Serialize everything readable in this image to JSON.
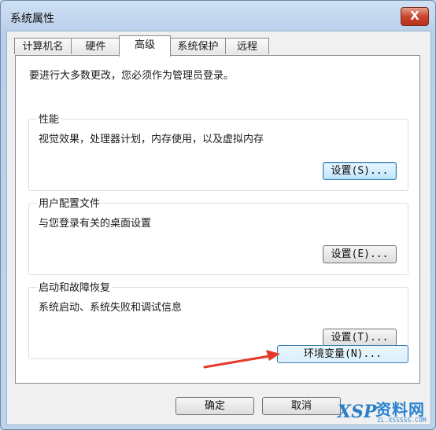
{
  "window": {
    "title": "系统属性",
    "close_label": "X"
  },
  "tabs": [
    {
      "label": "计算机名",
      "active": false
    },
    {
      "label": "硬件",
      "active": false
    },
    {
      "label": "高级",
      "active": true
    },
    {
      "label": "系统保护",
      "active": false
    },
    {
      "label": "远程",
      "active": false
    }
  ],
  "advanced": {
    "intro": "要进行大多数更改，您必须作为管理员登录。",
    "performance": {
      "title": "性能",
      "description": "视觉效果，处理器计划，内存使用，以及虚拟内存",
      "button": "设置(S)..."
    },
    "user_profiles": {
      "title": "用户配置文件",
      "description": "与您登录有关的桌面设置",
      "button": "设置(E)..."
    },
    "startup_recovery": {
      "title": "启动和故障恢复",
      "description": "系统启动、系统失败和调试信息",
      "button": "设置(T)..."
    },
    "env_button": "环境变量(N)..."
  },
  "footer": {
    "ok": "确定",
    "cancel": "取消"
  },
  "watermark": {
    "logo_text": "XSP",
    "main": "资料网",
    "sub": "ZL.XSSSSS.COM"
  },
  "colors": {
    "arrow": "#e53a2b",
    "title_bar": "#bfd4ec",
    "close_button": "#c9452d"
  }
}
